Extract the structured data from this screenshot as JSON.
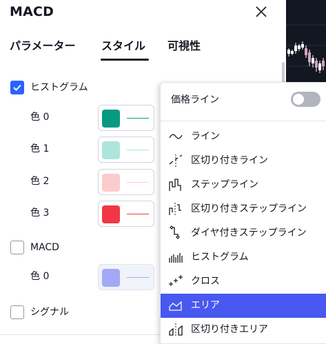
{
  "dialog": {
    "title": "MACD",
    "tabs": [
      {
        "label": "パラメーター"
      },
      {
        "label": "スタイル"
      },
      {
        "label": "可視性"
      }
    ]
  },
  "style": {
    "histogram": {
      "label": "ヒストグラム",
      "checked": true,
      "colors": [
        {
          "label": "色 0",
          "color": "#089981",
          "line": "#089981"
        },
        {
          "label": "色 1",
          "color": "#ace5dc",
          "line": "#ace5dc"
        },
        {
          "label": "色 2",
          "color": "#fccbcd",
          "line": "#fccbcd"
        },
        {
          "label": "色 3",
          "color": "#f23645",
          "line": "#f23645"
        }
      ]
    },
    "macd": {
      "label": "MACD",
      "checked": false,
      "colors": [
        {
          "label": "色 0",
          "color": "#a3aaf5",
          "line": "#a3aaf5"
        }
      ]
    },
    "signal": {
      "label": "シグナル",
      "checked": false
    }
  },
  "plot_style_menu": {
    "price_line_label": "価格ライン",
    "price_line_enabled": false,
    "items": [
      {
        "label": "ライン",
        "icon": "line-icon"
      },
      {
        "label": "区切り付きライン",
        "icon": "line-with-breaks-icon"
      },
      {
        "label": "ステップライン",
        "icon": "step-line-icon"
      },
      {
        "label": "区切り付きステップライン",
        "icon": "step-line-with-breaks-icon"
      },
      {
        "label": "ダイヤ付きステップライン",
        "icon": "step-line-with-diamonds-icon"
      },
      {
        "label": "ヒストグラム",
        "icon": "histogram-icon"
      },
      {
        "label": "クロス",
        "icon": "cross-icon"
      },
      {
        "label": "エリア",
        "icon": "area-icon",
        "selected": true
      },
      {
        "label": "区切り付きエリア",
        "icon": "area-with-breaks-icon"
      }
    ]
  },
  "colors": {
    "accent": "#2962ff",
    "selected_item": "#4858f0",
    "text": "#131722"
  }
}
